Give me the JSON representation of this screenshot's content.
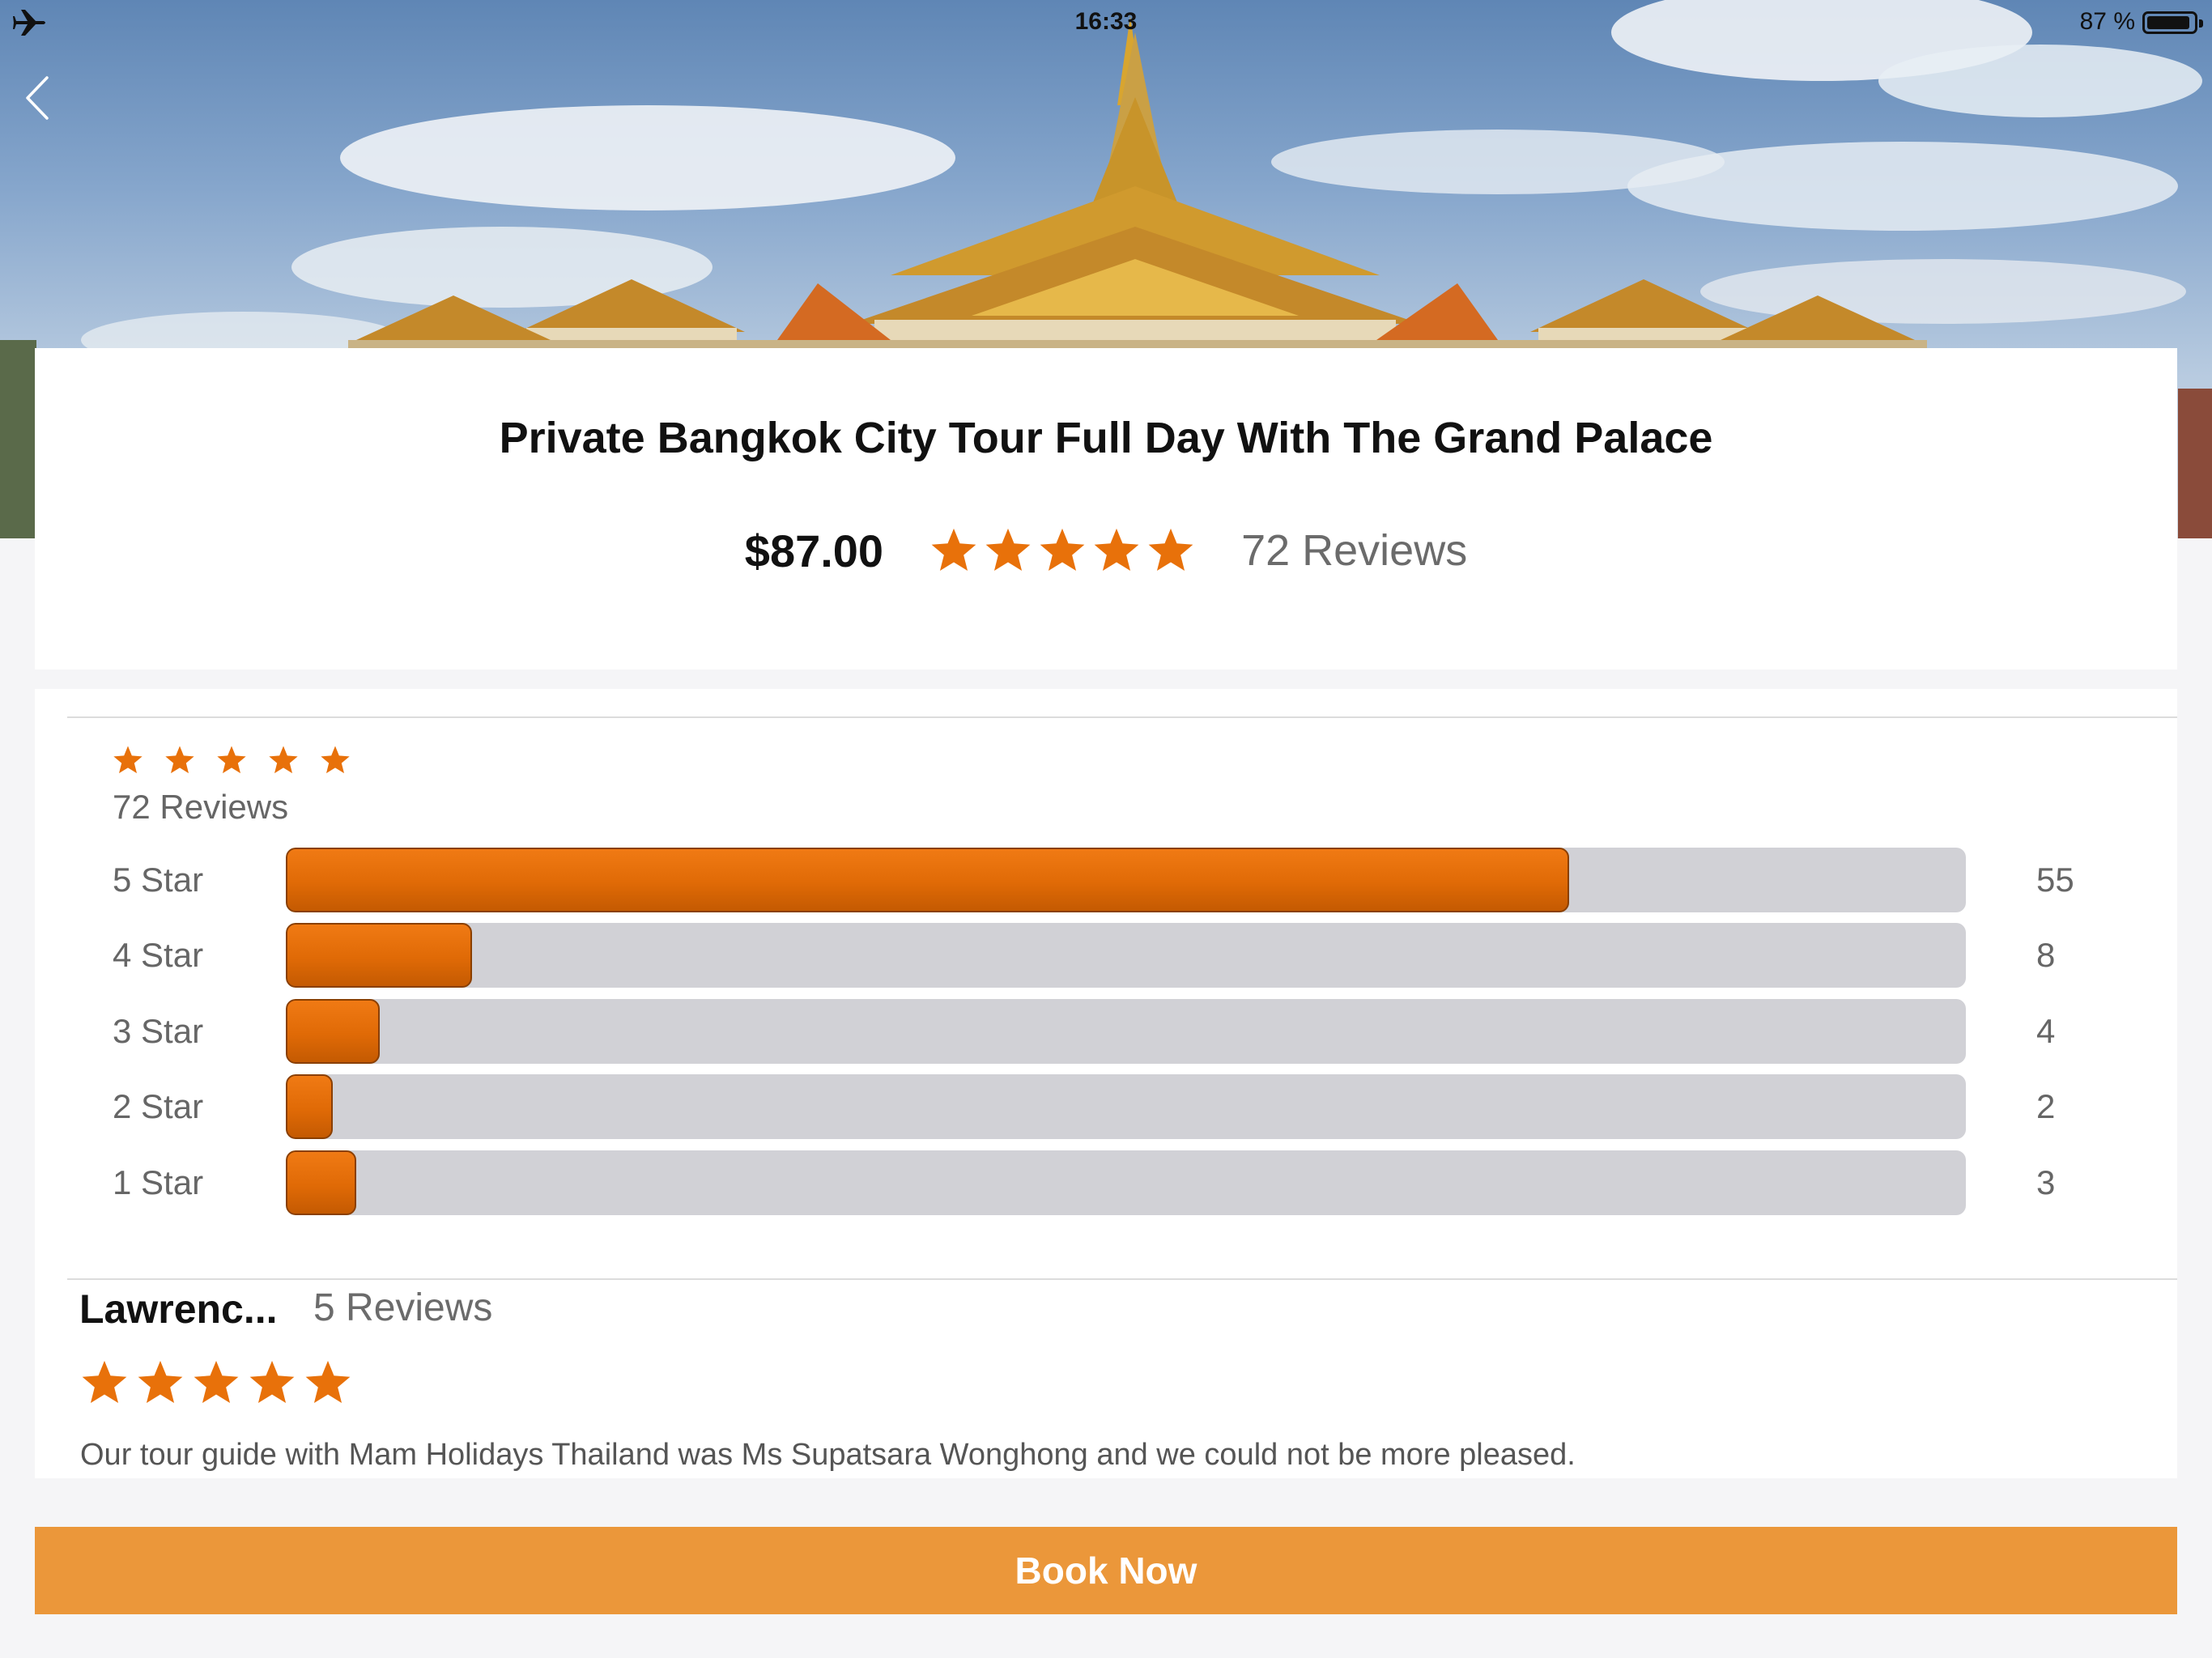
{
  "status_bar": {
    "time": "16:33",
    "battery_text": "87 %",
    "battery_level": 0.87,
    "airplane_icon": "airplane-icon"
  },
  "header": {
    "back_icon": "chevron-left-icon"
  },
  "tour": {
    "title": "Private Bangkok City Tour Full Day With The Grand Palace",
    "price": "$87.00",
    "rating": 5,
    "reviews_label": "72 Reviews"
  },
  "summary": {
    "rating": 5,
    "reviews_label": "72 Reviews",
    "total": 72,
    "distribution": [
      {
        "label": "5 Star",
        "count": "55",
        "value": 55,
        "fraction": 0.764
      },
      {
        "label": "4 Star",
        "count": "8",
        "value": 8,
        "fraction": 0.111
      },
      {
        "label": "3 Star",
        "count": "4",
        "value": 4,
        "fraction": 0.056
      },
      {
        "label": "2 Star",
        "count": "2",
        "value": 2,
        "fraction": 0.028
      },
      {
        "label": "1 Star",
        "count": "3",
        "value": 3,
        "fraction": 0.042
      }
    ]
  },
  "review": {
    "reviewer_name": "Lawrenc...",
    "reviewer_reviews": "5 Reviews",
    "rating": 5,
    "text": "Our tour guide with Mam Holidays Thailand was Ms Supatsara Wonghong and we could not be more pleased."
  },
  "actions": {
    "book_label": "Book Now"
  },
  "colors": {
    "accent_orange": "#e8710a",
    "button_orange": "#eb973a",
    "bar_track": "#d1d1d6",
    "muted_text": "#666666"
  }
}
